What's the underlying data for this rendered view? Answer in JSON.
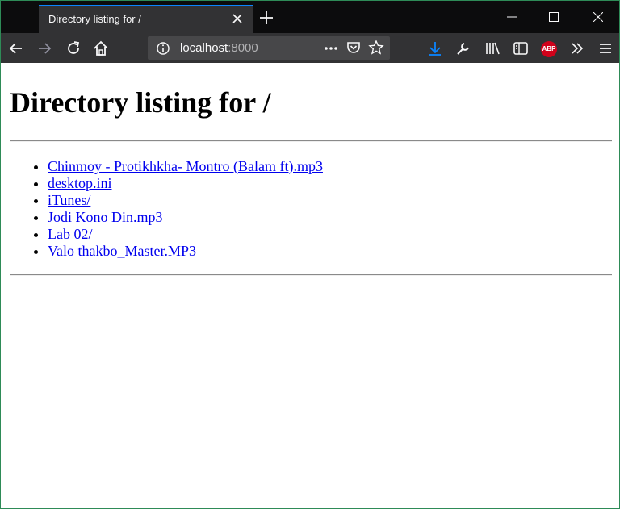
{
  "browser": {
    "tab_title": "Directory listing for /",
    "url_host": "localhost",
    "url_port": ":8000",
    "abp_label": "ABP",
    "accent_color": "#0a84ff"
  },
  "page": {
    "heading": "Directory listing for /",
    "entries": [
      "Chinmoy - Protikhkha- Montro (Balam ft).mp3",
      "desktop.ini",
      "iTunes/",
      "Jodi Kono Din.mp3",
      "Lab 02/",
      "Valo thakbo_Master.MP3"
    ],
    "link_color": "#0000ee"
  }
}
